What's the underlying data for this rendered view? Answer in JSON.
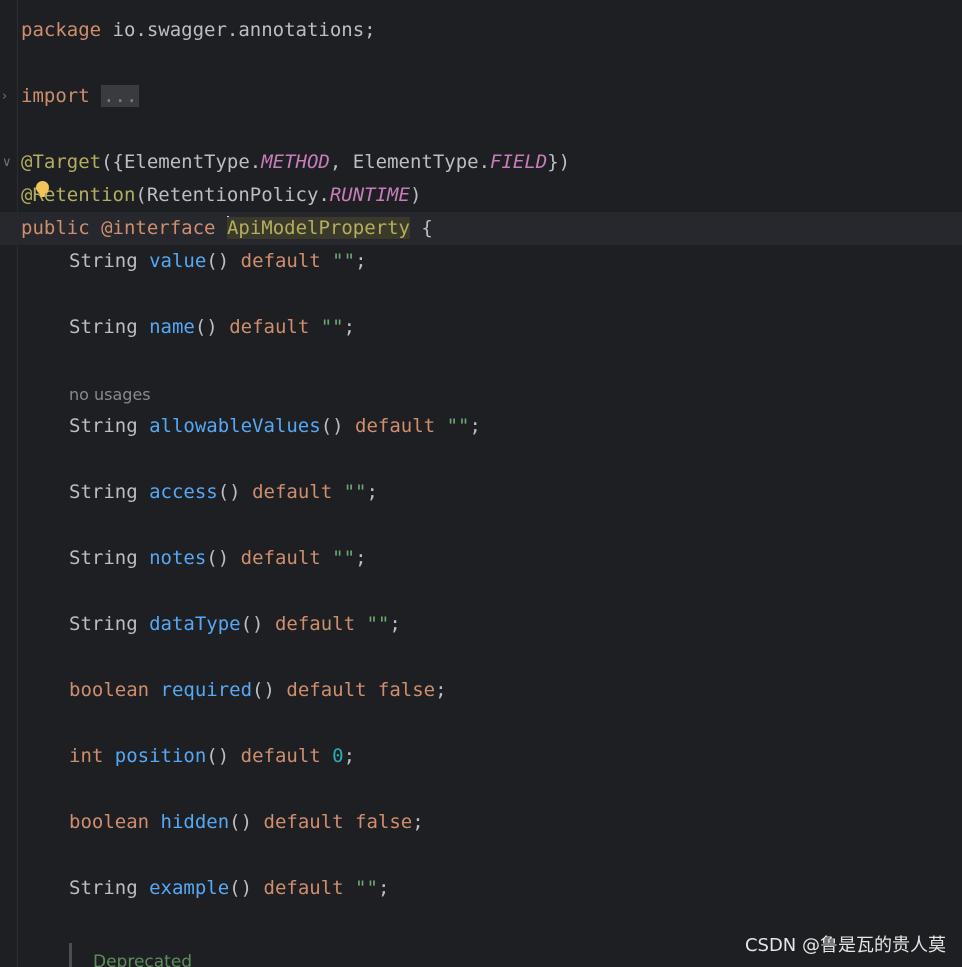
{
  "editor": {
    "package_line": {
      "kw": "package",
      "rest": " io.swagger.annotations;"
    },
    "import_line": {
      "kw": "import",
      "folded": "..."
    },
    "target_line": {
      "ann": "@Target",
      "p1": "({ElementType.",
      "c1": "METHOD",
      "p2": ", ElementType.",
      "c2": "FIELD",
      "p3": "})"
    },
    "retention_line": {
      "ann": "@Retention",
      "p1": "(RetentionPolicy.",
      "c1": "RUNTIME",
      "p2": ")"
    },
    "interface_line": {
      "kw1": "public",
      "kw2": "@interface",
      "name": "ApiModelProperty",
      "brace": " {"
    },
    "inlay_hint": "no usages",
    "members": [
      {
        "type": "String",
        "name": "value",
        "default": "\"\""
      },
      {
        "type": "String",
        "name": "name",
        "default": "\"\""
      },
      {
        "type": "String",
        "name": "allowableValues",
        "default": "\"\""
      },
      {
        "type": "String",
        "name": "access",
        "default": "\"\""
      },
      {
        "type": "String",
        "name": "notes",
        "default": "\"\""
      },
      {
        "type": "String",
        "name": "dataType",
        "default": "\"\""
      },
      {
        "type": "boolean",
        "name": "required",
        "default": "false"
      },
      {
        "type": "int",
        "name": "position",
        "default": "0"
      },
      {
        "type": "boolean",
        "name": "hidden",
        "default": "false"
      },
      {
        "type": "String",
        "name": "example",
        "default": "\"\""
      }
    ],
    "keyword_default": "default",
    "parens": "()",
    "semicolon": ";",
    "doc_comment": "Deprecated"
  },
  "watermark": "CSDN @鲁是瓦的贵人莫"
}
